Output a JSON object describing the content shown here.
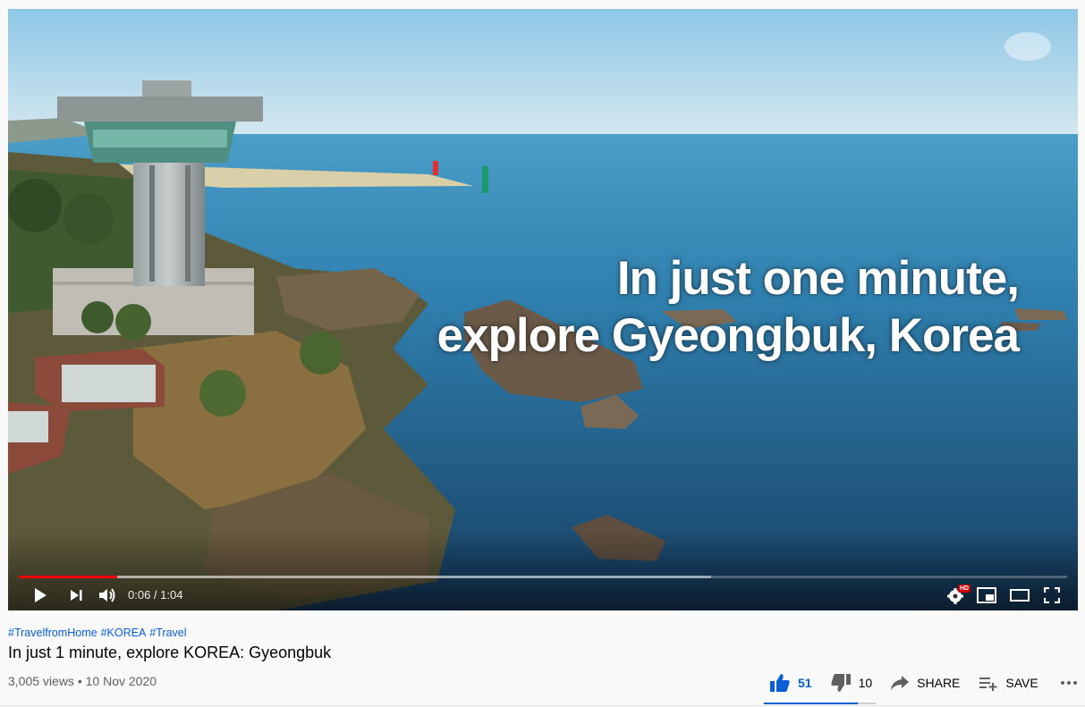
{
  "player": {
    "overlay_text": [
      "In just one minute,",
      "explore Gyeongbuk, Korea"
    ],
    "time_current": "0:06",
    "time_total": "1:04",
    "time_display": "0:06 / 1:04",
    "progress_fraction": 0.094,
    "buffered_fraction": 0.66,
    "hd_badge": "HD",
    "colors": {
      "progress": "#ff0000",
      "hd_badge": "#cc0000"
    },
    "controls": [
      {
        "name": "play-icon"
      },
      {
        "name": "next-icon"
      },
      {
        "name": "volume-icon"
      },
      {
        "name": "settings-icon"
      },
      {
        "name": "miniplayer-icon"
      },
      {
        "name": "theater-mode-icon"
      },
      {
        "name": "fullscreen-icon"
      }
    ]
  },
  "video": {
    "hashtags": [
      "#TravelfromHome",
      "#KOREA",
      "#Travel"
    ],
    "title": "In just 1 minute, explore KOREA: Gyeongbuk",
    "views": "3,005 views",
    "separator": "•",
    "date": "10 Nov 2020"
  },
  "actions": {
    "like_count": "51",
    "dislike_count": "10",
    "share_label": "SHARE",
    "save_label": "SAVE",
    "like_ratio": 0.836,
    "accent_color": "#065fd4"
  }
}
